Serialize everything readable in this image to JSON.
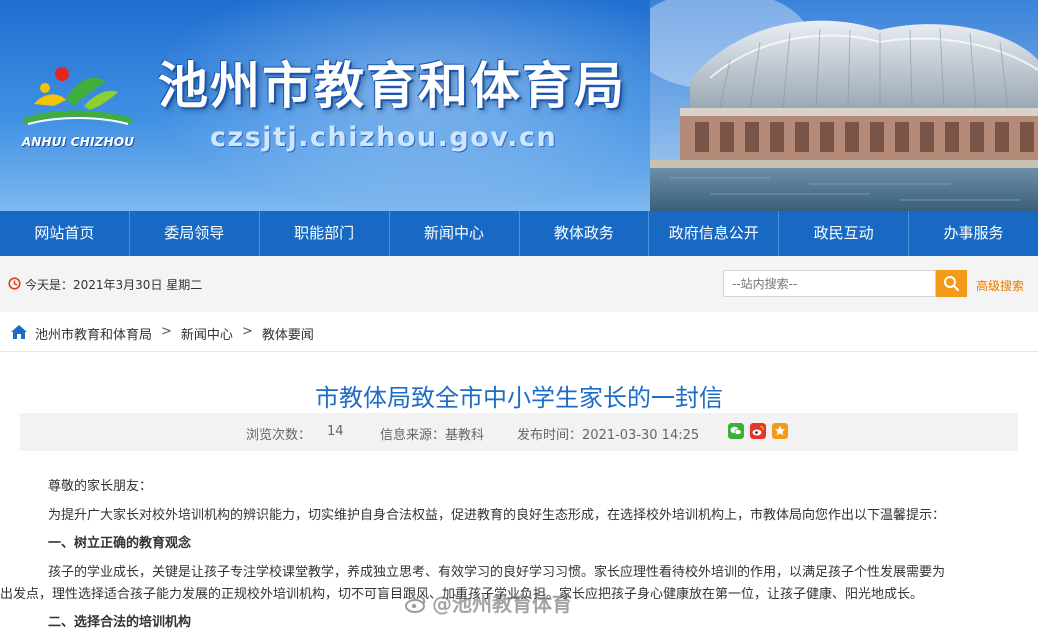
{
  "header": {
    "site_title": "池州市教育和体育局",
    "domain": "czsjtj.chizhou.gov.cn",
    "logo_text": "ANHUI CHIZHOU"
  },
  "nav": {
    "items": [
      "网站首页",
      "委局领导",
      "职能部门",
      "新闻中心",
      "教体政务",
      "政府信息公开",
      "政民互动",
      "办事服务"
    ]
  },
  "utility": {
    "date_text": "今天是：2021年3月30日 星期二",
    "search_placeholder": "--站内搜索--",
    "advanced_search": "高级搜索"
  },
  "breadcrumb": {
    "items": [
      "池州市教育和体育局",
      "新闻中心",
      "教体要闻"
    ],
    "separator": ">"
  },
  "article": {
    "title": "市教体局致全市中小学生家长的一封信",
    "views_label": "浏览次数：",
    "views": "14",
    "source": "信息来源：基教科",
    "published": "发布时间：2021-03-30 14:25",
    "greeting": "尊敬的家长朋友：",
    "intro": "为提升广大家长对校外培训机构的辨识能力，切实维护自身合法权益，促进教育的良好生态形成，在选择校外培训机构上，市教体局向您作出以下温馨提示：",
    "section1_heading": "一、树立正确的教育观念",
    "section1_line1": "孩子的学业成长，关键是让孩子专注学校课堂教学，养成独立思考、有效学习的良好学习习惯。家长应理性看待校外培训的作用，以满足孩子个性发展需要为",
    "section1_line2": "出发点，理性选择适合孩子能力发展的正规校外培训机构，切不可盲目跟风、加重孩子学业负担。家长应把孩子身心健康放在第一位，让孩子健康、阳光地成长。",
    "section2_heading": "二、选择合法的培训机构"
  },
  "watermark": "@池州教育体育",
  "colors": {
    "nav_bg": "#1769c4",
    "title_blue": "#1f6cc7",
    "search_orange": "#f39a1a",
    "adv_search_orange": "#e67a00"
  },
  "icons": [
    "clock-icon",
    "search-icon",
    "home-icon",
    "wechat-icon",
    "weibo-icon",
    "favorite-icon"
  ]
}
